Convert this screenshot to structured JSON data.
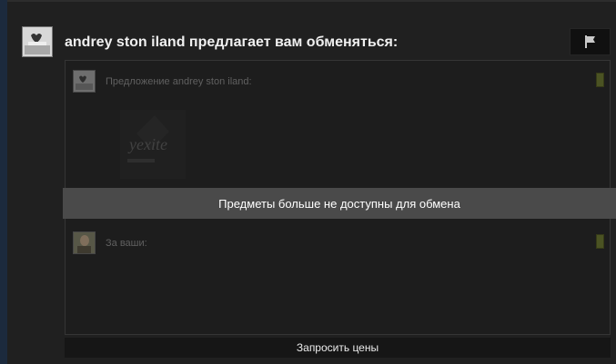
{
  "trade": {
    "headline": "andrey ston iland предлагает вам обменяться:",
    "offer_label": "Предложение andrey ston iland:",
    "yours_label": "За ваши:",
    "unavailable_message": "Предметы больше не доступны для обмена",
    "request_prices_button": "Запросить цены",
    "item_watermark_text": "yexite"
  },
  "icons": {
    "flag": "flag-icon",
    "avatar": "avatar-image",
    "item": "item-image"
  },
  "colors": {
    "background": "#202020",
    "ready_indicator": "#4b5323",
    "unavailable_bar": "#4a4a4a",
    "side_strip": "#1c2a3d"
  }
}
